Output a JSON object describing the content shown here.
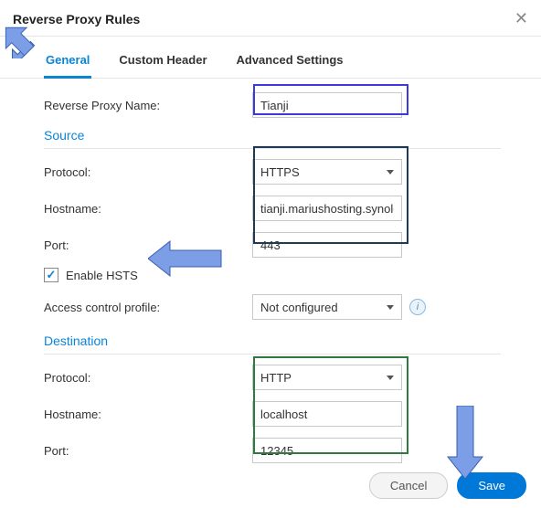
{
  "header": {
    "title": "Reverse Proxy Rules"
  },
  "tabs": {
    "general": "General",
    "custom_header": "Custom Header",
    "advanced": "Advanced Settings"
  },
  "fields": {
    "name_label": "Reverse Proxy Name:",
    "name_value": "Tianji"
  },
  "source": {
    "heading": "Source",
    "protocol_label": "Protocol:",
    "protocol_value": "HTTPS",
    "hostname_label": "Hostname:",
    "hostname_value": "tianji.mariushosting.synolo",
    "port_label": "Port:",
    "port_value": "443",
    "enable_hsts_label": "Enable HSTS",
    "enable_hsts_checked": true,
    "access_profile_label": "Access control profile:",
    "access_profile_value": "Not configured"
  },
  "destination": {
    "heading": "Destination",
    "protocol_label": "Protocol:",
    "protocol_value": "HTTP",
    "hostname_label": "Hostname:",
    "hostname_value": "localhost",
    "port_label": "Port:",
    "port_value": "12345"
  },
  "buttons": {
    "cancel": "Cancel",
    "save": "Save"
  }
}
